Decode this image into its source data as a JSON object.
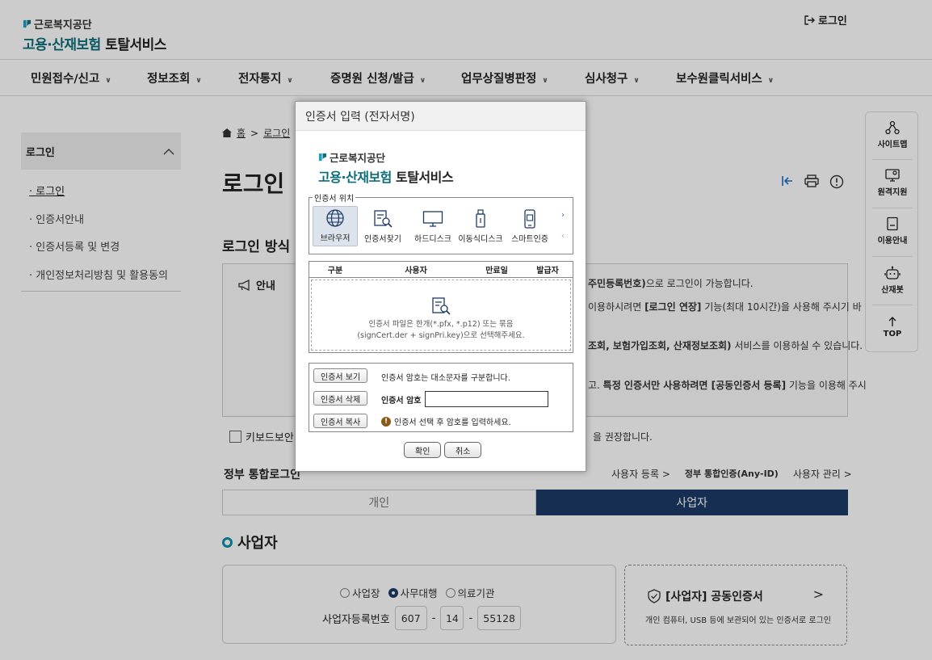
{
  "header": {
    "org": "근로복지공단",
    "service_a": "고용·산재보험",
    "service_b": "토탈서비스",
    "login_link": "로그인"
  },
  "gnb": [
    {
      "label": "민원접수/신고"
    },
    {
      "label": "정보조회"
    },
    {
      "label": "전자통지"
    },
    {
      "label": "증명원 신청/발급"
    },
    {
      "label": "업무상질병판정"
    },
    {
      "label": "심사청구"
    },
    {
      "label": "보수원클릭서비스"
    }
  ],
  "lnb": {
    "title": "로그인",
    "items": [
      {
        "label": "로그인"
      },
      {
        "label": "인증서안내"
      },
      {
        "label": "인증서등록 및 변경"
      },
      {
        "label": "개인정보처리방침 및 활용동의"
      }
    ]
  },
  "breadcrumb": {
    "home": "홈",
    "current": "로그인"
  },
  "page": {
    "title": "로그인",
    "section_title": "로그인 방식"
  },
  "notice": {
    "label": "안내",
    "lines": [
      {
        "html": "<b>주민등록번호)</b>으로 로그인이 가능합니다."
      },
      {
        "html": "이용하시려면 <b>[로그인 연장]</b> 기능(최대 10시간)을 사용해 주시기 바"
      },
      {
        "html": "<b>조회, 보험가입조회, 산재정보조회)</b> 서비스를 이용하실 수 있습니다."
      },
      {
        "html": "고. <b>특정 인증서만 사용하려면 [공동인증서 등록]</b> 기능을 이용해 주시"
      }
    ]
  },
  "keyboard": {
    "label": "키보드보안",
    "right": "을 권장합니다."
  },
  "gov": {
    "title": "정부 통합로그인",
    "link1": "사용자 등록",
    "link2": "정부 통합인증(Any-ID)",
    "link3": "사용자 관리"
  },
  "tabs": {
    "individual": "개인",
    "business": "사업자"
  },
  "business": {
    "title": "사업자",
    "radios": [
      {
        "label": "사업장",
        "checked": false
      },
      {
        "label": "사무대행",
        "checked": true
      },
      {
        "label": "의료기관",
        "checked": false
      }
    ],
    "brn_label": "사업자등록번호",
    "brn": [
      "607",
      "14",
      "55128"
    ],
    "cert_title": "[사업자] 공동인증서",
    "cert_desc": "개인 컴퓨터, USB 등에 보관되어 있는 인증서로 로그인"
  },
  "quickmenu": [
    {
      "label": "사이트맵",
      "icon": "sitemap-icon"
    },
    {
      "label": "원격지원",
      "icon": "remote-support-icon"
    },
    {
      "label": "이용안내",
      "icon": "guide-book-icon"
    },
    {
      "label": "산재봇",
      "icon": "chatbot-icon"
    },
    {
      "label": "TOP",
      "icon": "arrow-up-icon"
    }
  ],
  "modal": {
    "title": "인증서 입력 (전자서명)",
    "location_label": "인증서 위치",
    "locations": [
      {
        "label": "브라우저",
        "icon": "globe-icon"
      },
      {
        "label": "인증서찾기",
        "icon": "cert-search-icon"
      },
      {
        "label": "하드디스크",
        "icon": "monitor-icon"
      },
      {
        "label": "이동식디스크",
        "icon": "usb-icon"
      },
      {
        "label": "스마트인증",
        "icon": "smartphone-icon"
      }
    ],
    "columns": [
      "구분",
      "사용자",
      "만료일",
      "발급자"
    ],
    "empty_line1": "인증서 파일은 한개(*.pfx, *.p12) 또는 묶음",
    "empty_line2": "(signCert.der + signPri.key)으로 선택해주세요.",
    "view_btn": "인증서 보기",
    "delete_btn": "인증서 삭제",
    "copy_btn": "인증서 복사",
    "case_note": "인증서 암호는 대소문자를 구분합니다.",
    "pw_label": "인증서 암호",
    "pw_value": "",
    "warn_text": "인증서 선택 후 암호를 입력하세요.",
    "ok": "확인",
    "cancel": "취소"
  }
}
